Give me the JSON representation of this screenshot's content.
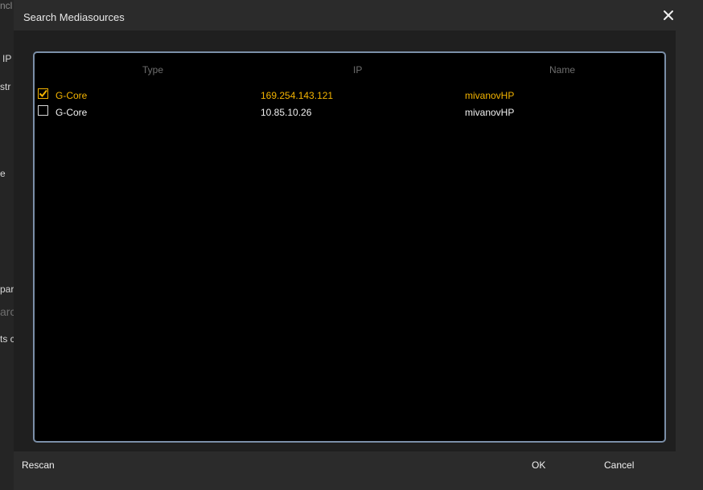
{
  "background": {
    "fragments": [
      "ncl",
      "IP",
      "str",
      "e",
      "par",
      "arc",
      "ts c"
    ]
  },
  "dialog": {
    "title": "Search Mediasources",
    "close_icon": "close-icon",
    "columns": [
      "Type",
      "IP",
      "Name"
    ],
    "rows": [
      {
        "checked": true,
        "type": "G-Core",
        "ip": "169.254.143.121",
        "name": "mivanovHP"
      },
      {
        "checked": false,
        "type": "G-Core",
        "ip": "10.85.10.26",
        "name": "mivanovHP"
      }
    ],
    "buttons": {
      "rescan": "Rescan",
      "ok": "OK",
      "cancel": "Cancel"
    },
    "colors": {
      "selected_text": "#f4b400",
      "list_border": "#7b8fa8"
    }
  }
}
